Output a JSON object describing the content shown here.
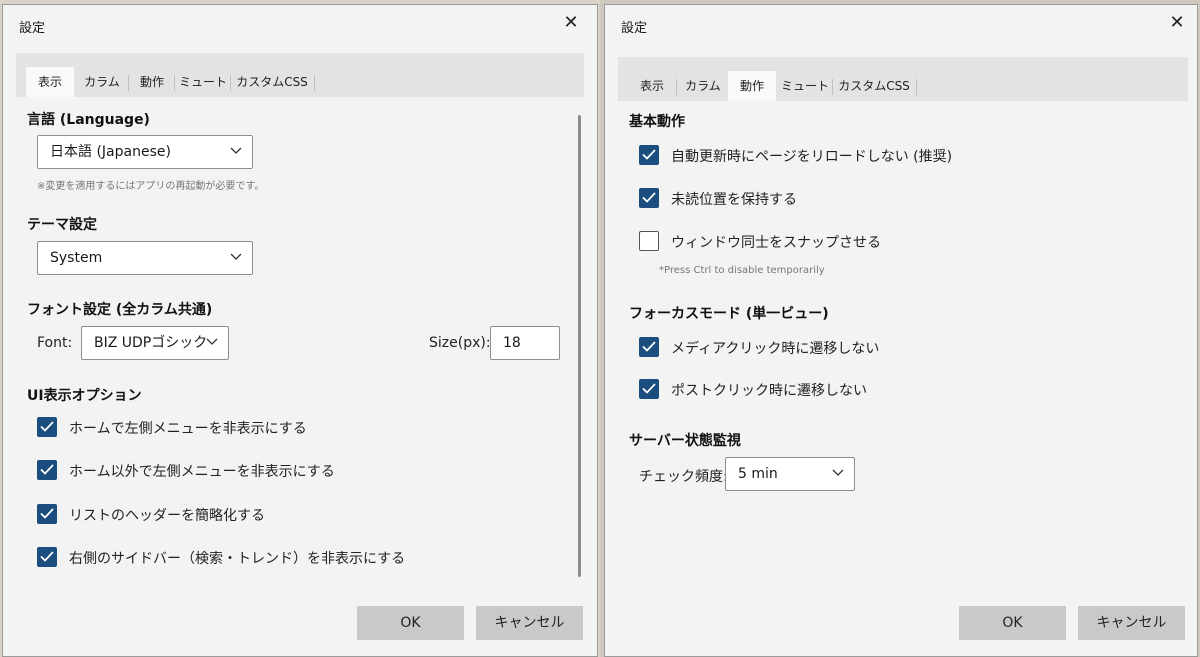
{
  "left": {
    "title": "設定",
    "tabs": [
      "表示",
      "カラム",
      "動作",
      "ミュート",
      "カスタムCSS"
    ],
    "language": {
      "heading": "言語 (Language)",
      "value": "日本語 (Japanese)",
      "note": "※変更を適用するにはアプリの再起動が必要です。"
    },
    "theme": {
      "heading": "テーマ設定",
      "value": "System"
    },
    "font": {
      "heading": "フォント設定 (全カラム共通)",
      "font_label": "Font:",
      "font_value": "BIZ UDPゴシック",
      "size_label": "Size(px):",
      "size_value": "18"
    },
    "ui_options": {
      "heading": "UI表示オプション",
      "items": [
        {
          "label": "ホームで左側メニューを非表示にする",
          "checked": true
        },
        {
          "label": "ホーム以外で左側メニューを非表示にする",
          "checked": true
        },
        {
          "label": "リストのヘッダーを簡略化する",
          "checked": true
        },
        {
          "label": "右側のサイドバー（検索・トレンド）を非表示にする",
          "checked": true
        }
      ]
    },
    "ok_label": "OK",
    "cancel_label": "キャンセル"
  },
  "right": {
    "title": "設定",
    "tabs": [
      "表示",
      "カラム",
      "動作",
      "ミュート",
      "カスタムCSS"
    ],
    "basic": {
      "heading": "基本動作",
      "items": [
        {
          "label": "自動更新時にページをリロードしない (推奨)",
          "checked": true
        },
        {
          "label": "未読位置を保持する",
          "checked": true
        },
        {
          "label": "ウィンドウ同士をスナップさせる",
          "checked": false
        }
      ],
      "note": "*Press Ctrl to disable temporarily"
    },
    "focus": {
      "heading": "フォーカスモード (単一ビュー)",
      "items": [
        {
          "label": "メディアクリック時に遷移しない",
          "checked": true
        },
        {
          "label": "ポストクリック時に遷移しない",
          "checked": true
        }
      ]
    },
    "server": {
      "heading": "サーバー状態監視",
      "check_label": "チェック頻度:",
      "check_value": "5 min"
    },
    "ok_label": "OK",
    "cancel_label": "キャンセル"
  },
  "colors": {
    "checkbox": "#1b4d7e",
    "button": "#c9c9c9",
    "active_tab": "#f9f9f9"
  }
}
